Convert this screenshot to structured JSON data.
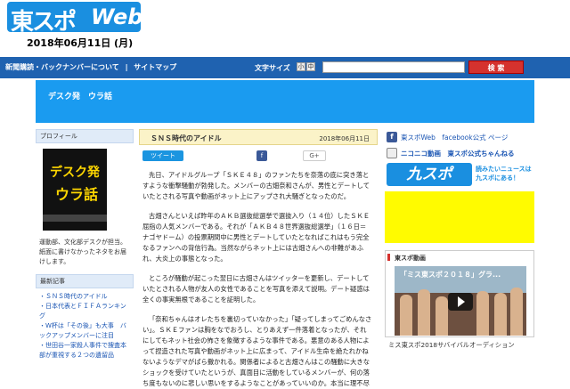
{
  "header": {
    "logo_jp": "東スポ",
    "logo_web": "Web",
    "date": "2018年06月11日 (月)"
  },
  "nav": {
    "links": [
      "新聞購読・バックナンバーについて",
      "|",
      "サイトマップ"
    ],
    "font_size_label": "文字サイズ",
    "font_sizes": [
      "小",
      "中",
      "大"
    ],
    "search_button": "検 索"
  },
  "band": {
    "title": "デスク発　ウラ話"
  },
  "left": {
    "profile_heading": "プロフィール",
    "promo_line1": "デスク発",
    "promo_line2": "ウラ話",
    "profile_text": "運動部、文化部デスクが担当。紙面に書けなかったネタをお届けします。",
    "recent_heading": "最新記事",
    "recent_items": [
      "・ＳＮＳ時代のアイドル",
      "・日本代表とＦＩＦＡランキング",
      "・W杯は「その後」も大事　バックアップメンバーに注目",
      "・世田谷一家殺人事件で捜査本部が重視する２つの遺留品"
    ]
  },
  "article": {
    "title": "ＳＮＳ時代のアイドル",
    "date": "2018年06月11日",
    "tweet_label": "ツイート",
    "fb_label": "f",
    "gplus_label": "G+",
    "paragraphs": [
      "先日、アイドルグループ「ＳＫＥ４８」のファンたちを奈落の底に突き落とすような衝撃騒動が勃発した。メンバーの古畑奈和さんが、男性とデートしていたとされる写真や動画がネット上にアップされ大騒ぎとなったのだ。",
      "古畑さんといえば昨年のＡＫＢ選抜総選挙で選抜入り（１４位）したＳＫＥ屈指の人気メンバーである。それが「ＡＫＢ４８世界選抜総選挙」（１６日＝ナゴヤドーム）の投票期間中に男性とデートしていたとなればこれはもう完全なるファンへの背信行為。当然ながらネット上には古畑さんへの非難があふれ、大炎上の事態となった。",
      "ところが騒動が起こった翌日に古畑さんはツイッターを更新し、デートしていたとされる人物が友人の女性であることを写真を添えて説明。デート疑惑は全くの事実無根であることを証明した。",
      "「奈和ちゃんはオレたちを裏切っていなかった」「疑ってしまってごめんなさい」。ＳＫＥファンは胸をなでおろし、とりあえず一件落着となったが、それにしてもネット社会の怖さを象徴するような事件である。悪意のある人物によって捏造された写真や動画がネット上に広まって、アイドル生命を絶たれかねないようなデマがばら撒かれる。関係者によると古畑さんはこの騒動に大きなショックを受けていたというが、真面目に活動をしているメンバーが、何の落ち度もないのに悲しい思いをするようなことがあっていいのか。本当に理不尽"
    ]
  },
  "right": {
    "fb_link": "東スポWeb　facebook公式 ページ",
    "nico_link": "ニコニコ動画　東スポ公式ちゃんねる",
    "kyu_logo": "九スポ",
    "kyu_line1": "読みたいニュースは",
    "kyu_line2": "九スポにある！",
    "video_heading": "東スポ動画",
    "video_title": "「ミス東スポ２０１８」グラ...",
    "video_caption": "ミス東スポ2018サバイバルオーディション"
  },
  "colors": {
    "brand_blue": "#1a8fe0",
    "nav_blue": "#1f62b0",
    "band_blue": "#1a9bf0",
    "search_red": "#d5322e",
    "ad_yellow": "#fffb00"
  }
}
